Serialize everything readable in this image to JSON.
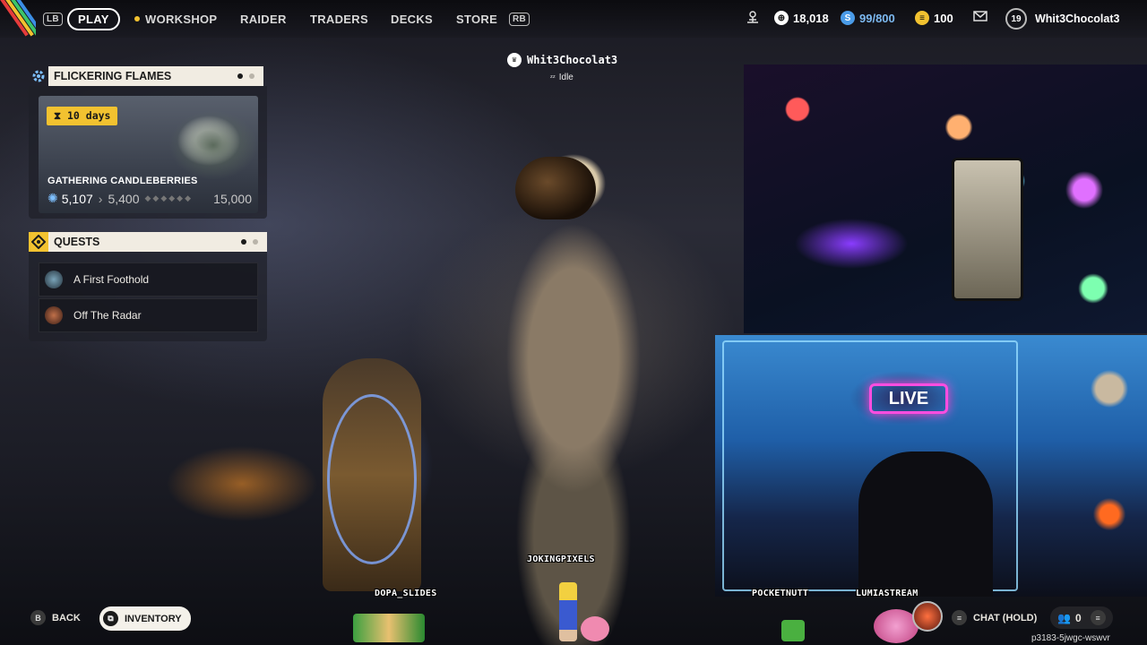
{
  "topbar": {
    "lb": "LB",
    "rb": "RB",
    "tabs": [
      {
        "label": "PLAY",
        "active": true
      },
      {
        "label": "WORKSHOP"
      },
      {
        "label": "RAIDER"
      },
      {
        "label": "TRADERS"
      },
      {
        "label": "DECKS"
      },
      {
        "label": "STORE"
      }
    ],
    "currency_1": "18,018",
    "capacity": "99/800",
    "currency_2": "100",
    "level": "19",
    "username": "Whit3Chocolat3"
  },
  "event": {
    "title": "FLICKERING FLAMES",
    "timer": "10 days",
    "card_title": "GATHERING CANDLEBERRIES",
    "current": "5,107",
    "next": "5,400",
    "max": "15,000"
  },
  "quests": {
    "title": "QUESTS",
    "items": [
      {
        "label": "A First Foothold"
      },
      {
        "label": "Off The Radar"
      }
    ]
  },
  "player": {
    "name": "Whit3Chocolat3",
    "status": "Idle"
  },
  "overlay_tags": {
    "jokingpixels": "JOKINGPIXELS",
    "dopa_slides": "DOPA_SLIDES",
    "pocketnutt": "POCKETNUTT",
    "lumiastream": "LUMIASTREAM"
  },
  "bottombar": {
    "back_key": "B",
    "back_label": "BACK",
    "inventory_label": "INVENTORY",
    "chat_label": "CHAT (HOLD)",
    "party_count": "0"
  },
  "session_code": "p3183-5jwgc-wswvr",
  "colors": {
    "accent_yellow": "#f2c230",
    "panel_header": "#f1ece2",
    "capacity_blue": "#4a9be8"
  }
}
